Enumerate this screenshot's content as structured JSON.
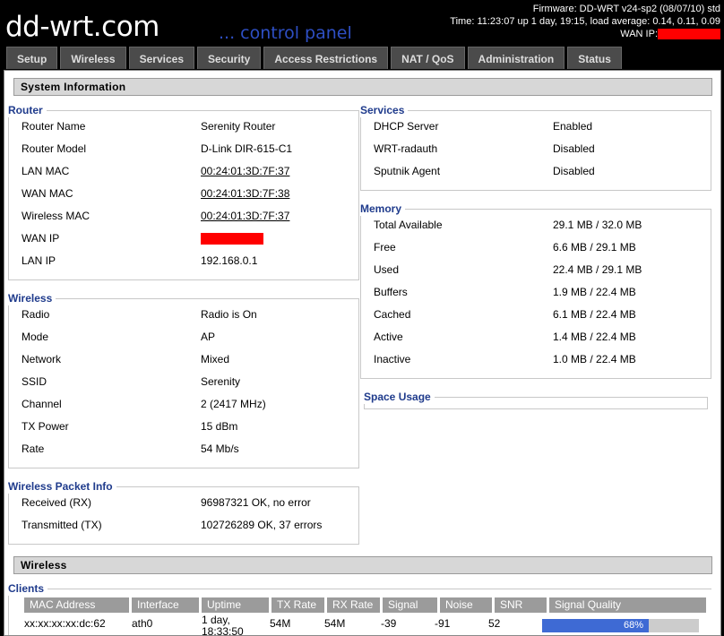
{
  "header": {
    "logo_main": "dd-wrt",
    "logo_suffix": ".com",
    "tagline": "... control panel",
    "firmware": "Firmware: DD-WRT v24-sp2 (08/07/10) std",
    "time": "Time: 11:23:07 up 1 day, 19:15, load average: 0.14, 0.11, 0.09",
    "wan_ip_label": "WAN IP:"
  },
  "tabs": [
    "Setup",
    "Wireless",
    "Services",
    "Security",
    "Access Restrictions",
    "NAT / QoS",
    "Administration",
    "Status"
  ],
  "system_info_title": "System Information",
  "router": {
    "legend": "Router",
    "rows": [
      {
        "label": "Router Name",
        "value": "Serenity Router"
      },
      {
        "label": "Router Model",
        "value": "D-Link DIR-615-C1"
      },
      {
        "label": "LAN MAC",
        "value": "00:24:01:3D:7F:37"
      },
      {
        "label": "WAN MAC",
        "value": "00:24:01:3D:7F:38"
      },
      {
        "label": "Wireless MAC",
        "value": "00:24:01:3D:7F:37"
      },
      {
        "label": "WAN IP",
        "value": ""
      },
      {
        "label": "LAN IP",
        "value": "192.168.0.1"
      }
    ]
  },
  "wireless_box": {
    "legend": "Wireless",
    "rows": [
      {
        "label": "Radio",
        "value": "Radio is On"
      },
      {
        "label": "Mode",
        "value": "AP"
      },
      {
        "label": "Network",
        "value": "Mixed"
      },
      {
        "label": "SSID",
        "value": "Serenity"
      },
      {
        "label": "Channel",
        "value": "2 (2417 MHz)"
      },
      {
        "label": "TX Power",
        "value": "15 dBm"
      },
      {
        "label": "Rate",
        "value": "54 Mb/s"
      }
    ]
  },
  "packet_info": {
    "legend": "Wireless Packet Info",
    "rows": [
      {
        "label": "Received (RX)",
        "value": "96987321 OK, no error"
      },
      {
        "label": "Transmitted (TX)",
        "value": "102726289 OK, 37 errors"
      }
    ]
  },
  "services": {
    "legend": "Services",
    "rows": [
      {
        "label": "DHCP Server",
        "value": "Enabled"
      },
      {
        "label": "WRT-radauth",
        "value": "Disabled"
      },
      {
        "label": "Sputnik Agent",
        "value": "Disabled"
      }
    ]
  },
  "memory": {
    "legend": "Memory",
    "rows": [
      {
        "label": "Total Available",
        "value": "29.1 MB / 32.0 MB"
      },
      {
        "label": "Free",
        "value": "6.6 MB / 29.1 MB"
      },
      {
        "label": "Used",
        "value": "22.4 MB / 29.1 MB"
      },
      {
        "label": "Buffers",
        "value": "1.9 MB / 22.4 MB"
      },
      {
        "label": "Cached",
        "value": "6.1 MB / 22.4 MB"
      },
      {
        "label": "Active",
        "value": "1.4 MB / 22.4 MB"
      },
      {
        "label": "Inactive",
        "value": "1.0 MB / 22.4 MB"
      }
    ]
  },
  "space_usage": {
    "legend": "Space Usage"
  },
  "wireless_section_title": "Wireless",
  "clients": {
    "legend": "Clients",
    "columns": [
      "MAC Address",
      "Interface",
      "Uptime",
      "TX Rate",
      "RX Rate",
      "Signal",
      "Noise",
      "SNR",
      "Signal Quality"
    ],
    "row": {
      "mac": "xx:xx:xx:xx:dc:62",
      "interface": "ath0",
      "uptime_line1": "1 day,",
      "uptime_line2": "18:33:50",
      "tx_rate": "54M",
      "rx_rate": "54M",
      "signal": "-39",
      "noise": "-91",
      "snr": "52",
      "signal_quality": "68%",
      "signal_quality_fraction": 0.68
    }
  },
  "colors": {
    "accent": "#1f3b8c",
    "redaction": "#ff0000",
    "quality_bar": "#3e6ad4"
  }
}
